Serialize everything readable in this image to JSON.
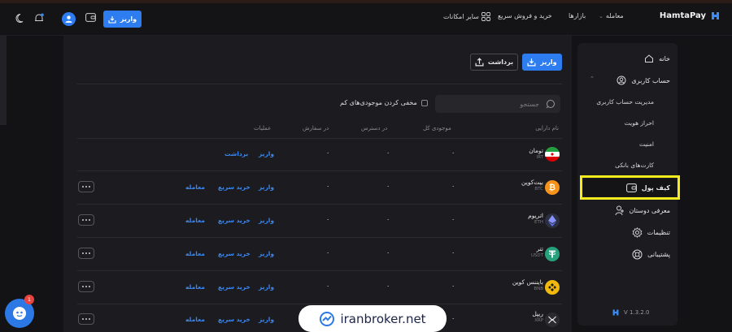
{
  "header": {
    "brand": "HamtaPay",
    "nav": [
      {
        "label": "معامله",
        "has_dropdown": true
      },
      {
        "label": "بازارها"
      },
      {
        "label": "خرید و فروش سریع"
      },
      {
        "label": "سایر امکانات"
      }
    ],
    "deposit_label": "واریز"
  },
  "sidebar": {
    "items": [
      {
        "label": "خانه",
        "icon": "home-icon"
      },
      {
        "label": "حساب کاربری",
        "icon": "user-icon",
        "expanded": true
      },
      {
        "label": "مدیریت حساب کاربری",
        "sub": true
      },
      {
        "label": "احراز هویت",
        "sub": true
      },
      {
        "label": "امنیت",
        "sub": true
      },
      {
        "label": "کارت‌های بانکی",
        "sub": true
      },
      {
        "label": "کیف پول",
        "icon": "wallet-icon",
        "active": true
      },
      {
        "label": "معرفی دوستان",
        "icon": "referral-icon"
      },
      {
        "label": "تنظیمات",
        "icon": "gear-icon"
      },
      {
        "label": "پشتیبانی",
        "icon": "support-icon"
      }
    ],
    "version": "V 1.3.2.0"
  },
  "wallet": {
    "deposit_label": "واریز",
    "withdraw_label": "برداشت",
    "search_placeholder": "جستجو",
    "hide_zero_label": "مخفی کردن موجودی‌های کم",
    "columns": [
      "نام دارایی",
      "موجودی کل",
      "در دسترس",
      "در سفارش",
      "عملیات"
    ],
    "rows": [
      {
        "name": "تومان",
        "symbol": "IRT",
        "total": "۰",
        "available": "۰",
        "in_order": "۰",
        "actions": [
          "واریز",
          "برداشت"
        ]
      },
      {
        "name": "بیت‌کوین",
        "symbol": "BTC",
        "total": "۰",
        "available": "۰",
        "in_order": "۰",
        "actions": [
          "واریز",
          "خرید سریع",
          "معامله"
        ]
      },
      {
        "name": "اتریوم",
        "symbol": "ETH",
        "total": "۰",
        "available": "۰",
        "in_order": "۰",
        "actions": [
          "واریز",
          "خرید سریع",
          "معامله"
        ]
      },
      {
        "name": "تتر",
        "symbol": "USDT",
        "total": "۰",
        "available": "۰",
        "in_order": "۰",
        "actions": [
          "واریز",
          "خرید سریع",
          "معامله"
        ]
      },
      {
        "name": "بایننس کوین",
        "symbol": "BNB",
        "total": "۰",
        "available": "۰",
        "in_order": "۰",
        "actions": [
          "واریز",
          "خرید سریع",
          "معامله"
        ]
      },
      {
        "name": "ریپل",
        "symbol": "XRP",
        "total": "۰",
        "available": "۰",
        "in_order": "۰",
        "actions": [
          "واریز",
          "خرید سریع",
          "معامله"
        ]
      }
    ]
  },
  "support_badge": "1",
  "watermark": "iranbroker.net",
  "colors": {
    "accent": "#2d7df0",
    "highlight": "#f4ec1d",
    "background": "#131316",
    "panel": "#1c1c20"
  }
}
